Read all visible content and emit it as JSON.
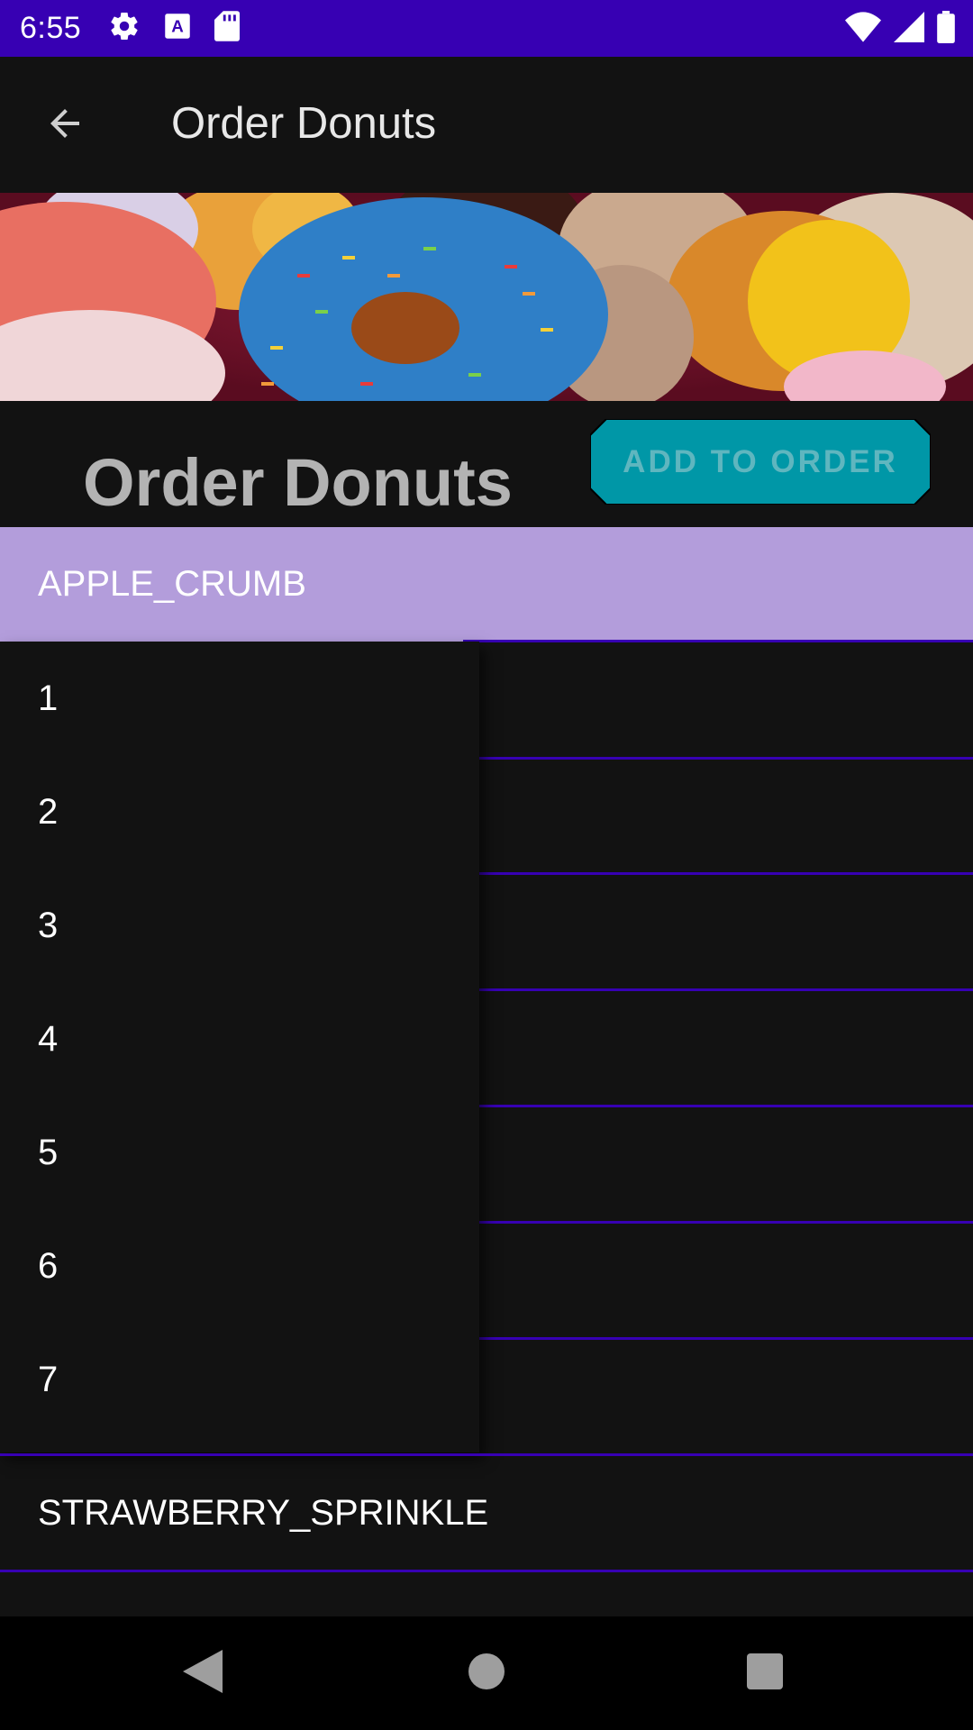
{
  "status_bar": {
    "time": "6:55",
    "icons_left": [
      "settings-icon",
      "a-icon",
      "sd-card-icon"
    ],
    "icons_right": [
      "wifi-icon",
      "signal-icon",
      "battery-icon"
    ],
    "color": "#3700b3"
  },
  "app_bar": {
    "title": "Order Donuts",
    "back_icon": "arrow-back-icon"
  },
  "header": {
    "title": "Order Donuts",
    "add_button_label": "ADD TO ORDER",
    "add_button_color": "#0097a7"
  },
  "spinner1": {
    "selected": "APPLE_CRUMB",
    "selected_bg": "#b39ddb",
    "options": [
      "1",
      "2",
      "3",
      "4",
      "5",
      "6",
      "7"
    ]
  },
  "spinner2": {
    "selected": "STRAWBERRY_SPRINKLE"
  },
  "nav_bar": {
    "icons": [
      "back-triangle-icon",
      "home-circle-icon",
      "recents-square-icon"
    ]
  }
}
